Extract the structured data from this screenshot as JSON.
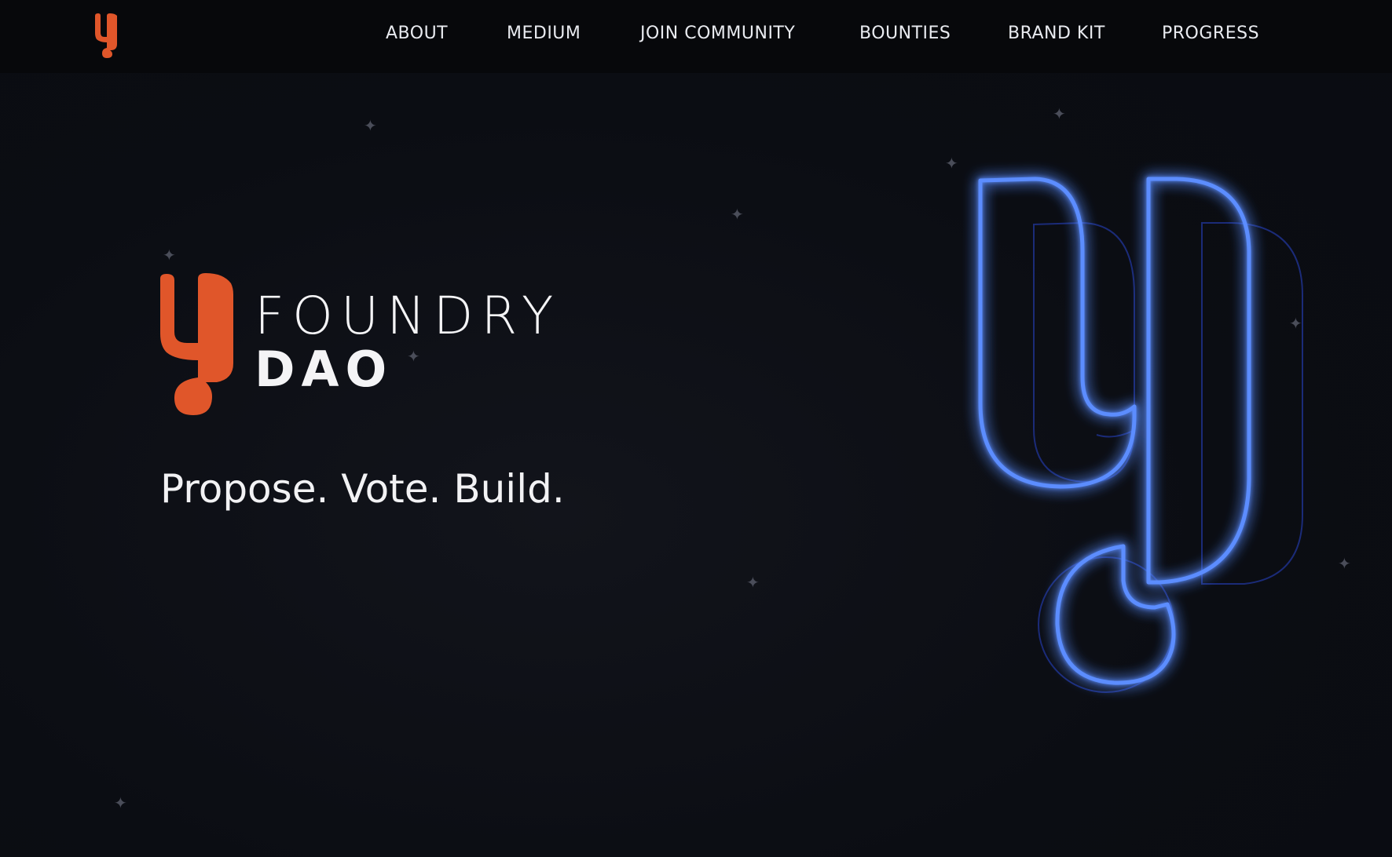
{
  "nav": {
    "logo_icon": "foundry-y-logo-icon",
    "items": [
      {
        "label": "ABOUT"
      },
      {
        "label": "MEDIUM"
      },
      {
        "label": "JOIN COMMUNITY"
      },
      {
        "label": "BOUNTIES"
      },
      {
        "label": "BRAND KIT"
      },
      {
        "label": "PROGRESS"
      }
    ]
  },
  "hero": {
    "logo_icon": "foundry-y-logo-icon",
    "brand_line_1": "FOUNDRY",
    "brand_line_2": "DAO",
    "tagline": "Propose. Vote. Build.",
    "art_icon": "neon-y-logo-icon"
  },
  "colors": {
    "background": "#0d0f14",
    "nav_background": "#07080b",
    "brand_orange": "#e0562a",
    "neon_blue": "#1d5bff",
    "text": "#f4f4f6"
  }
}
